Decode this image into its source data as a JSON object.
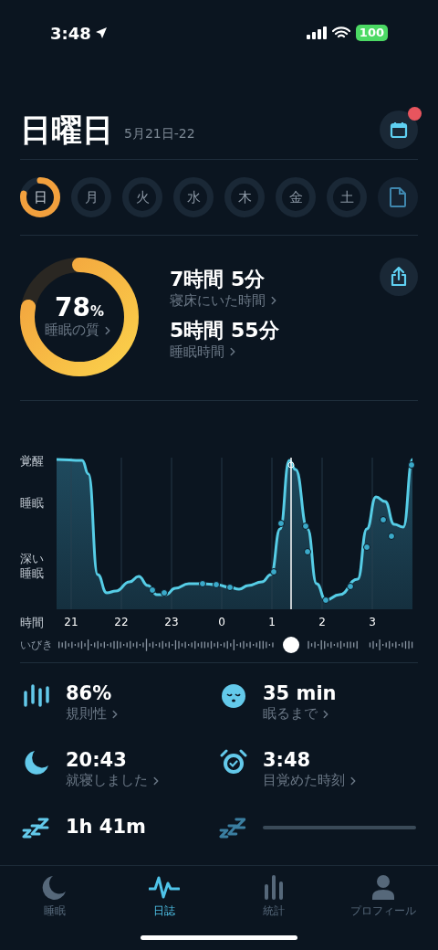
{
  "status_bar": {
    "time": "3:48",
    "battery": "100"
  },
  "header": {
    "title": "日曜日",
    "date_range": "5月21日-22",
    "calendar_badge": true
  },
  "days": [
    {
      "label": "日",
      "selected": true
    },
    {
      "label": "月",
      "selected": false
    },
    {
      "label": "火",
      "selected": false
    },
    {
      "label": "水",
      "selected": false
    },
    {
      "label": "木",
      "selected": false
    },
    {
      "label": "金",
      "selected": false
    },
    {
      "label": "土",
      "selected": false
    }
  ],
  "summary": {
    "quality": {
      "value": "78",
      "unit": "%",
      "label": "睡眠の質"
    },
    "metrics": [
      {
        "value": "7時間 5分",
        "label": "寝床にいた時間"
      },
      {
        "value": "5時間 55分",
        "label": "睡眠時間"
      }
    ]
  },
  "sleep_chart": {
    "stage_labels": [
      "覚醒",
      "睡眠",
      "深い睡眠"
    ],
    "time_label": "時間",
    "hours": [
      "21",
      "22",
      "23",
      "0",
      "1",
      "2",
      "3"
    ],
    "snore_label": "いびき"
  },
  "stats": [
    {
      "kind": "value",
      "value": "86%",
      "label": "規則性"
    },
    {
      "kind": "value",
      "value": "35 min",
      "label": "眠るまで"
    },
    {
      "kind": "value",
      "value": "20:43",
      "label": "就寝しました"
    },
    {
      "kind": "value",
      "value": "3:48",
      "label": "目覚めた時刻"
    },
    {
      "kind": "value",
      "value": "1h 41m"
    },
    {
      "kind": "loading"
    }
  ],
  "tabs": [
    {
      "label": "睡眠",
      "selected": false
    },
    {
      "label": "日誌",
      "selected": true
    },
    {
      "label": "統計",
      "selected": false
    },
    {
      "label": "プロフィール",
      "selected": false
    }
  ]
}
